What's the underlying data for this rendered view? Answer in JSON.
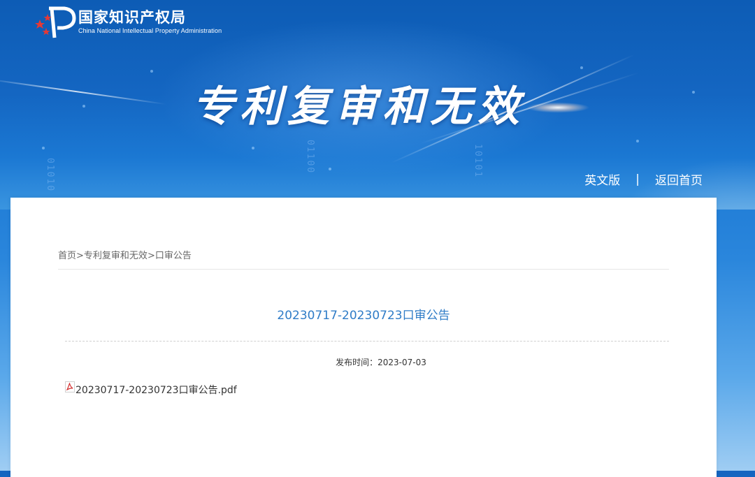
{
  "header": {
    "logo": {
      "name_cn": "国家知识产权局",
      "name_en": "China National Intellectual Property Administration"
    },
    "banner_title": "专利复审和无效",
    "links": [
      "英文版",
      "返回首页"
    ],
    "separator": "|"
  },
  "breadcrumb": {
    "home": "首页",
    "section": "专利复审和无效",
    "current": "口审公告",
    "sep": ">"
  },
  "article": {
    "title": "20230717-20230723口审公告",
    "publish_label": "发布时间：",
    "publish_date": "2023-07-03",
    "attachment": {
      "icon": "pdf-icon",
      "filename": "20230717-20230723口审公告.pdf"
    }
  },
  "colors": {
    "banner": "#1466c2",
    "title_link": "#2f7cc7",
    "panel": "#ffffff"
  }
}
